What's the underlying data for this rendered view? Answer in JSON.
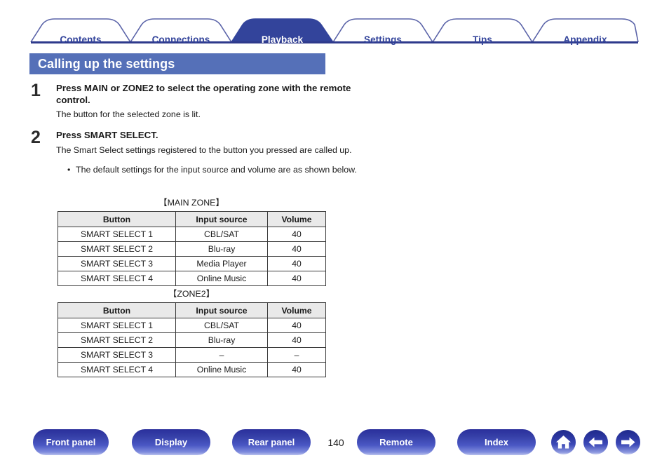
{
  "tabs": [
    {
      "label": "Contents",
      "active": false
    },
    {
      "label": "Connections",
      "active": false
    },
    {
      "label": "Playback",
      "active": true
    },
    {
      "label": "Settings",
      "active": false
    },
    {
      "label": "Tips",
      "active": false
    },
    {
      "label": "Appendix",
      "active": false
    }
  ],
  "page": {
    "title": "Calling up the settings",
    "number": "140"
  },
  "steps": [
    {
      "number": "1",
      "heading": "Press MAIN or ZONE2 to select the operating zone with the remote control.",
      "body": "The button for the selected zone is lit."
    },
    {
      "number": "2",
      "heading": "Press SMART SELECT.",
      "body": "The Smart Select settings registered to the button you pressed are called up.",
      "bullets": [
        "The default settings for the input source and volume are as shown below."
      ]
    }
  ],
  "tables": [
    {
      "caption": "【MAIN ZONE】",
      "headers": [
        "Button",
        "Input source",
        "Volume"
      ],
      "rows": [
        [
          "SMART SELECT 1",
          "CBL/SAT",
          "40"
        ],
        [
          "SMART SELECT 2",
          "Blu-ray",
          "40"
        ],
        [
          "SMART SELECT 3",
          "Media Player",
          "40"
        ],
        [
          "SMART SELECT 4",
          "Online Music",
          "40"
        ]
      ]
    },
    {
      "caption": "【ZONE2】",
      "headers": [
        "Button",
        "Input source",
        "Volume"
      ],
      "rows": [
        [
          "SMART SELECT 1",
          "CBL/SAT",
          "40"
        ],
        [
          "SMART SELECT 2",
          "Blu-ray",
          "40"
        ],
        [
          "SMART SELECT 3",
          "–",
          "–"
        ],
        [
          "SMART SELECT 4",
          "Online Music",
          "40"
        ]
      ]
    }
  ],
  "footer": {
    "buttons": [
      {
        "label": "Front panel"
      },
      {
        "label": "Display"
      },
      {
        "label": "Rear panel"
      },
      {
        "label": "Remote"
      },
      {
        "label": "Index"
      }
    ],
    "icons": [
      {
        "name": "home-icon"
      },
      {
        "name": "arrow-left-icon"
      },
      {
        "name": "arrow-right-icon"
      }
    ]
  },
  "colors": {
    "tab_active_bg": "#33449b",
    "tab_text": "#33449b",
    "title_bg": "#5570b8",
    "rule": "#2e3a8c",
    "table_header_bg": "#e9e9e9",
    "table_border": "#3a3a3a"
  }
}
